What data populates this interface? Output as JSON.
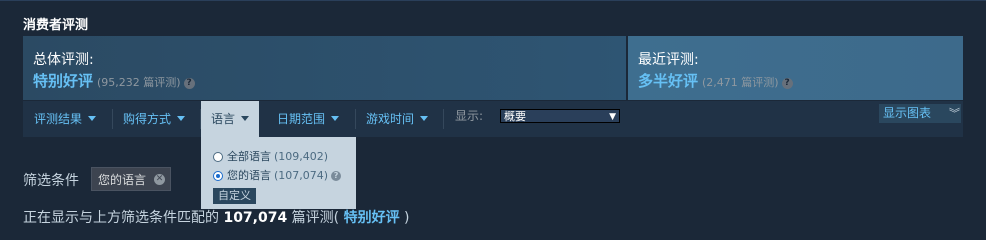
{
  "section_title": "消费者评测",
  "overall": {
    "label": "总体评测:",
    "rating": "特别好评",
    "count": "(95,232 篇评测)"
  },
  "recent": {
    "label": "最近评测:",
    "rating": "多半好评",
    "count": "(2,471 篇评测)"
  },
  "filterbar": {
    "items": [
      "评测结果",
      "购得方式",
      "语言",
      "日期范围",
      "游戏时间"
    ],
    "display_label": "显示:",
    "display_value": "概要",
    "graph_button": "显示图表"
  },
  "language_dropdown": {
    "options": [
      {
        "label": "全部语言",
        "count": "(109,402)",
        "selected": false
      },
      {
        "label": "您的语言",
        "count": "(107,074)",
        "selected": true
      }
    ],
    "custom_button": "自定义"
  },
  "filters": {
    "label": "筛选条件",
    "chip": "您的语言"
  },
  "showing": {
    "prefix": "正在显示与上方筛选条件匹配的",
    "count": "107,074",
    "mid": "篇评测(",
    "rating": "特别好评",
    "suffix": ")"
  },
  "colors": {
    "background": "#1b2838",
    "accent": "#66c0f4",
    "dropdown_bg": "#c6d4df"
  }
}
